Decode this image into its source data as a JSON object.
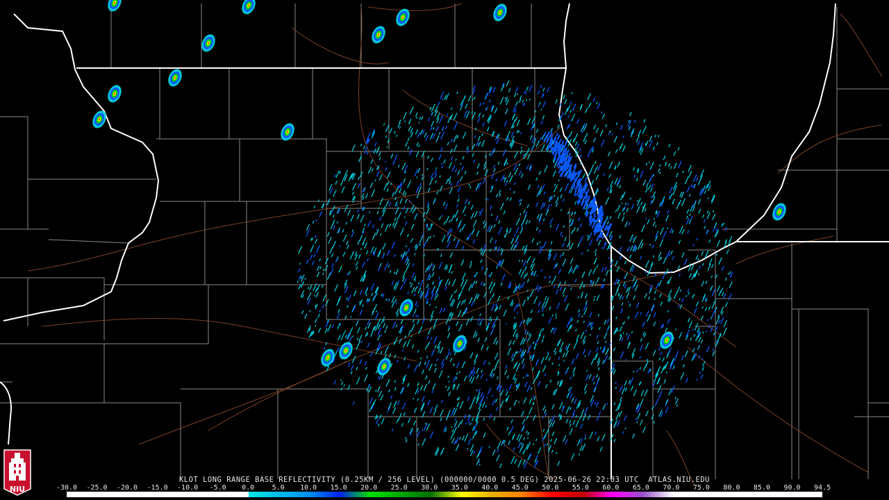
{
  "product": {
    "caption": "KLOT LONG RANGE BASE REFLECTIVITY (0.25KM / 256 LEVEL) (000000/0000 0.5 DEG) 2025-06-26 22:03 UTC  ATLAS.NIU.EDU"
  },
  "logo": {
    "text": "NIU",
    "background_color": "#c8102e"
  },
  "colorbar": {
    "labels": [
      "-30.0",
      "-25.0",
      "-20.0",
      "-15.0",
      "-10.0",
      "-5.0",
      "0.0",
      "5.0",
      "10.0",
      "15.0",
      "20.0",
      "25.0",
      "30.0",
      "35.0",
      "40.0",
      "45.0",
      "50.0",
      "55.0",
      "60.0",
      "65.0",
      "70.0",
      "75.0",
      "80.0",
      "85.0",
      "90.0",
      "94.5"
    ],
    "min": -30.0,
    "max": 94.5,
    "stops": [
      {
        "dbz": -30,
        "color": "#ffffff"
      },
      {
        "dbz": 0,
        "color": "#ffffff"
      },
      {
        "dbz": 0,
        "color": "#00e8e8"
      },
      {
        "dbz": 10,
        "color": "#0090f0"
      },
      {
        "dbz": 15,
        "color": "#0020f0"
      },
      {
        "dbz": 20,
        "color": "#00e000"
      },
      {
        "dbz": 30,
        "color": "#007000"
      },
      {
        "dbz": 35,
        "color": "#ffff00"
      },
      {
        "dbz": 40,
        "color": "#e8b000"
      },
      {
        "dbz": 45,
        "color": "#ff8000"
      },
      {
        "dbz": 50,
        "color": "#ff0000"
      },
      {
        "dbz": 55,
        "color": "#c00000"
      },
      {
        "dbz": 60,
        "color": "#ff00ff"
      },
      {
        "dbz": 65,
        "color": "#9955cc"
      },
      {
        "dbz": 70,
        "color": "#ffffff"
      },
      {
        "dbz": 94.5,
        "color": "#ffffff"
      }
    ]
  },
  "colors": {
    "background": "#000000",
    "state_lines": "#ffffff",
    "county_lines": "#8a8a8a",
    "highways": "#8b4a2b",
    "light_echo": "#00c8d8",
    "moderate_echo": "#0a5aff",
    "strong_echo_core": "#00d000"
  },
  "map_layers": [
    "state-borders",
    "lake-michigan-shoreline",
    "county-borders",
    "highways",
    "radar-echoes"
  ]
}
